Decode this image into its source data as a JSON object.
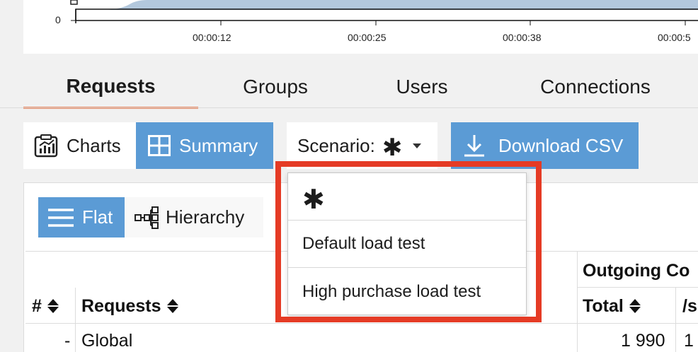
{
  "chart": {
    "y_tick": "0",
    "x_ticks": [
      "00:00:12",
      "00:00:25",
      "00:00:38",
      "00:00:5"
    ],
    "fill_color": "#b3c8dd"
  },
  "tabs": [
    {
      "label": "Requests",
      "active": true
    },
    {
      "label": "Groups",
      "active": false
    },
    {
      "label": "Users",
      "active": false
    },
    {
      "label": "Connections",
      "active": false
    }
  ],
  "toolbar": {
    "charts_label": "Charts",
    "summary_label": "Summary",
    "scenario_label": "Scenario:",
    "scenario_value": "✱",
    "download_label": "Download CSV"
  },
  "view_mode": {
    "flat_label": "Flat",
    "hierarchy_label": "Hierarchy"
  },
  "table": {
    "group_header": "Outgoing Co",
    "columns": [
      "#",
      "Requests",
      "Total",
      "/s"
    ],
    "rows": [
      {
        "num": "-",
        "name": "Global",
        "total": "1 990",
        "rate": "1"
      }
    ]
  },
  "dropdown": {
    "options": [
      "✱",
      "Default load test",
      "High purchase load test"
    ]
  },
  "colors": {
    "accent_blue": "#5b9bd5",
    "tab_underline": "#e8875f",
    "highlight_red": "#e53b25"
  }
}
